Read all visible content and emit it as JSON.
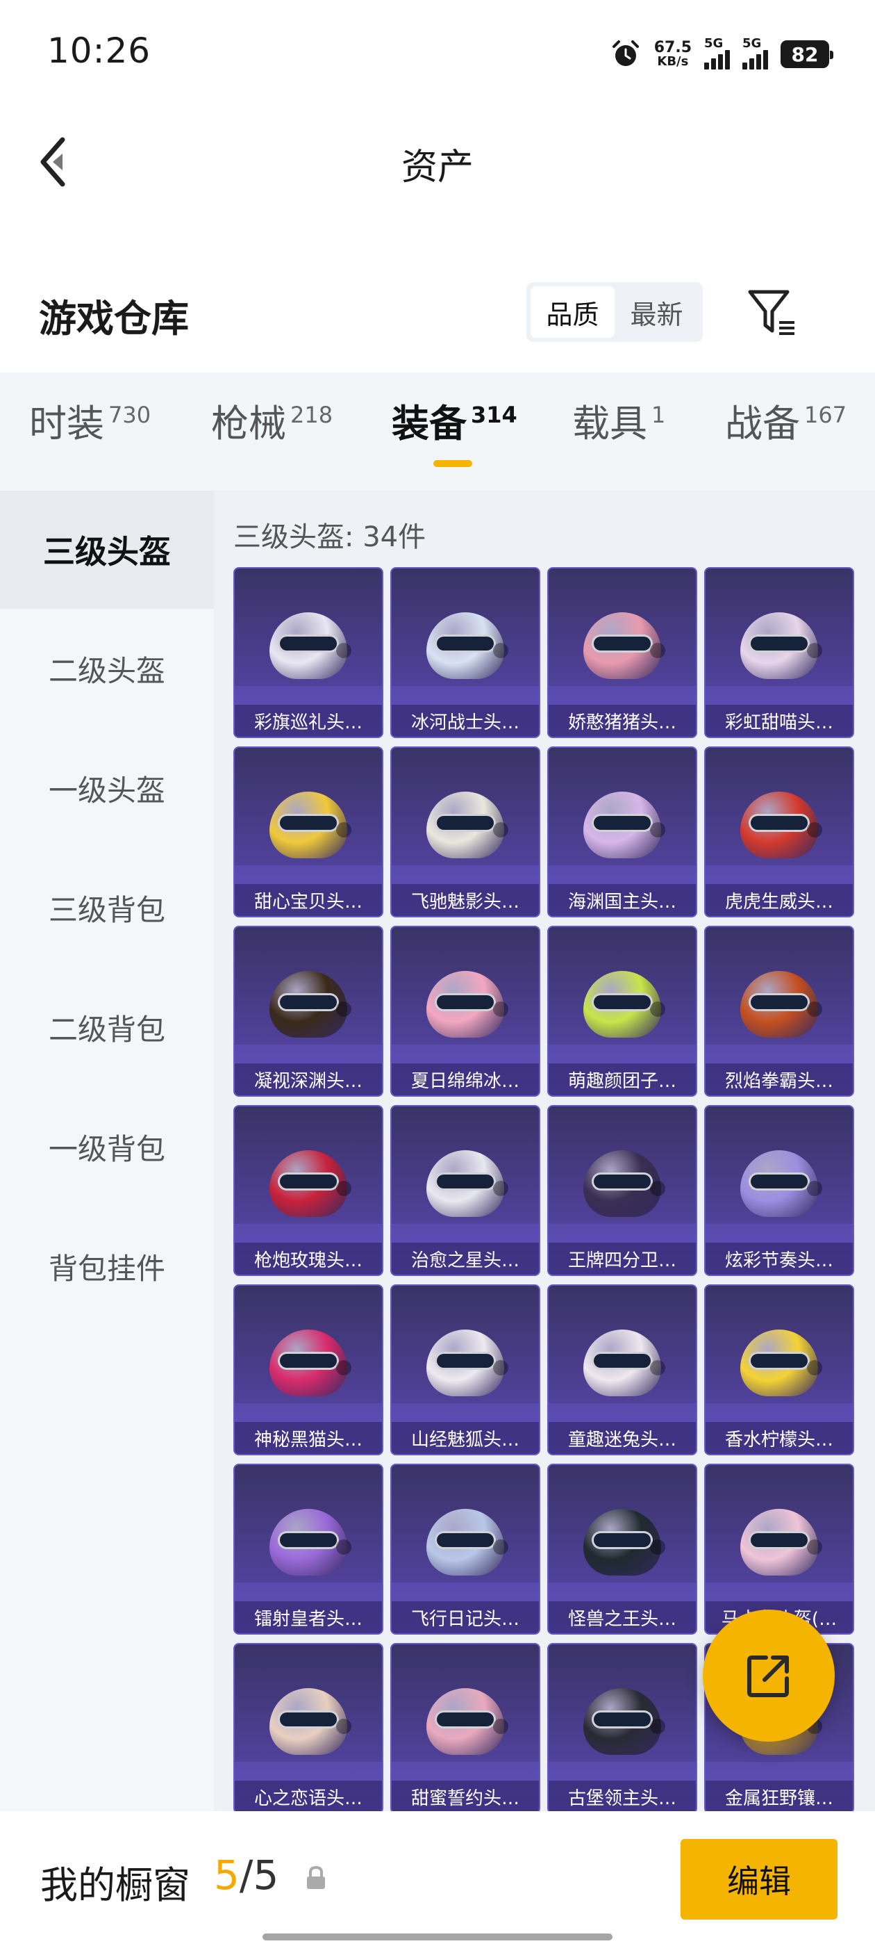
{
  "status_bar": {
    "time": "10:26",
    "net_speed_value": "67.5",
    "net_speed_unit": "KB/s",
    "sim1": "5G",
    "sim2": "5G",
    "battery": "82"
  },
  "header": {
    "title": "资产"
  },
  "section": {
    "title": "游戏仓库",
    "sort_options": [
      "品质",
      "最新"
    ],
    "active_sort": "品质"
  },
  "tabs": [
    {
      "label": "时装",
      "count": "730"
    },
    {
      "label": "枪械",
      "count": "218"
    },
    {
      "label": "装备",
      "count": "314"
    },
    {
      "label": "载具",
      "count": "1"
    },
    {
      "label": "战备",
      "count": "167"
    }
  ],
  "active_tab": "装备",
  "sidebar": {
    "items": [
      "三级头盔",
      "二级头盔",
      "一级头盔",
      "三级背包",
      "二级背包",
      "一级背包",
      "背包挂件"
    ],
    "active": "三级头盔"
  },
  "content": {
    "count_label": "三级头盔: 34件",
    "items": [
      {
        "name": "彩旗巡礼头…",
        "color": "#e9e6f2"
      },
      {
        "name": "冰河战士头…",
        "color": "#d8e2f2"
      },
      {
        "name": "娇憨猪猪头…",
        "color": "#e89aae"
      },
      {
        "name": "彩虹甜喵头…",
        "color": "#e7d5ea"
      },
      {
        "name": "甜心宝贝头…",
        "color": "#f0c93a"
      },
      {
        "name": "飞驰魅影头…",
        "color": "#e9e7dc"
      },
      {
        "name": "海渊国主头…",
        "color": "#d7b7e8"
      },
      {
        "name": "虎虎生威头…",
        "color": "#d43a2d"
      },
      {
        "name": "凝视深渊头…",
        "color": "#3b2a1a"
      },
      {
        "name": "夏日绵绵冰…",
        "color": "#f3a7bf"
      },
      {
        "name": "萌趣颜团子…",
        "color": "#c8e54a"
      },
      {
        "name": "烈焰拳霸头…",
        "color": "#c4501f"
      },
      {
        "name": "枪炮玫瑰头…",
        "color": "#c8223a"
      },
      {
        "name": "治愈之星头…",
        "color": "#e8e8ef"
      },
      {
        "name": "王牌四分卫…",
        "color": "#3a2e52"
      },
      {
        "name": "炫彩节奏头…",
        "color": "#9c8ee0"
      },
      {
        "name": "神秘黑猫头…",
        "color": "#d82b6b"
      },
      {
        "name": "山经魅狐头…",
        "color": "#eeeaf0"
      },
      {
        "name": "童趣迷兔头…",
        "color": "#efe8ef"
      },
      {
        "name": "香水柠檬头…",
        "color": "#f4d336"
      },
      {
        "name": "镭射皇者头…",
        "color": "#9a6ad8"
      },
      {
        "name": "飞行日记头…",
        "color": "#b9c8e8"
      },
      {
        "name": "怪兽之王头…",
        "color": "#1f2a2e"
      },
      {
        "name": "马卡龙头盔(…",
        "color": "#f0c4d8"
      },
      {
        "name": "心之恋语头…",
        "color": "#e9cfc0"
      },
      {
        "name": "甜蜜誓约头…",
        "color": "#e9a9bd"
      },
      {
        "name": "古堡领主头…",
        "color": "#2a2a34"
      },
      {
        "name": "金属狂野镶…",
        "color": "#c89a3a"
      }
    ]
  },
  "bottom_bar": {
    "showcase_label": "我的橱窗",
    "current": "5",
    "separator": "/",
    "total": "5",
    "edit_label": "编辑"
  },
  "colors": {
    "accent": "#f5b400",
    "card_bg": "#4d3f93"
  }
}
